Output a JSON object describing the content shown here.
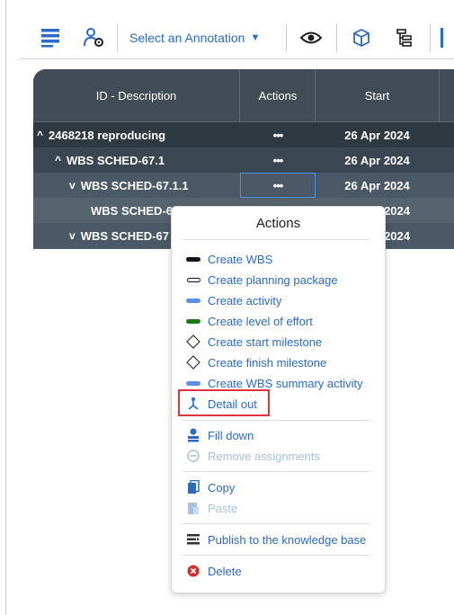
{
  "toolbar": {
    "annotation_select": "Select an Annotation",
    "caret": "▼"
  },
  "grid": {
    "headers": {
      "description": "ID - Description",
      "actions": "Actions",
      "start": "Start"
    },
    "rows": [
      {
        "chevron": "^",
        "label": "2468218 reproducing",
        "actions": "•••",
        "date": "26 Apr 2024"
      },
      {
        "chevron": "^",
        "label": "WBS SCHED-67.1",
        "actions": "•••",
        "date": "26 Apr 2024"
      },
      {
        "chevron": "v",
        "label": "WBS SCHED-67.1.1",
        "actions": "•••",
        "date": "26 Apr 2024"
      },
      {
        "chevron": "",
        "label": "WBS SCHED-67",
        "actions": "",
        "date": "2024"
      },
      {
        "chevron": "v",
        "label": "WBS SCHED-67",
        "actions": "",
        "date": "2024"
      }
    ]
  },
  "popup": {
    "title": "Actions",
    "items": [
      {
        "label": "Create WBS",
        "icon": "black-bar-icon"
      },
      {
        "label": "Create planning package",
        "icon": "outline-bar-icon"
      },
      {
        "label": "Create activity",
        "icon": "blue-bar-icon"
      },
      {
        "label": "Create level of effort",
        "icon": "green-bar-icon"
      },
      {
        "label": "Create start milestone",
        "icon": "diamond-icon"
      },
      {
        "label": "Create finish milestone",
        "icon": "diamond-icon"
      },
      {
        "label": "Create WBS summary activity",
        "icon": "blue-bar-icon"
      },
      {
        "label": "Detail out",
        "icon": "branch-icon"
      },
      {
        "label": "Fill down",
        "icon": "fill-down-icon"
      },
      {
        "label": "Remove assignments",
        "icon": "remove-circle-icon"
      },
      {
        "label": "Copy",
        "icon": "copy-icon"
      },
      {
        "label": "Paste",
        "icon": "paste-icon"
      },
      {
        "label": "Publish to the knowledge base",
        "icon": "publish-icon"
      },
      {
        "label": "Delete",
        "icon": "delete-icon"
      }
    ]
  },
  "colors": {
    "link": "#2a6bc9",
    "header_bg": "#414c57",
    "row_bg": "#3a4651",
    "highlight": "#e0343a",
    "level_of_effort": "#1a7a1a"
  }
}
